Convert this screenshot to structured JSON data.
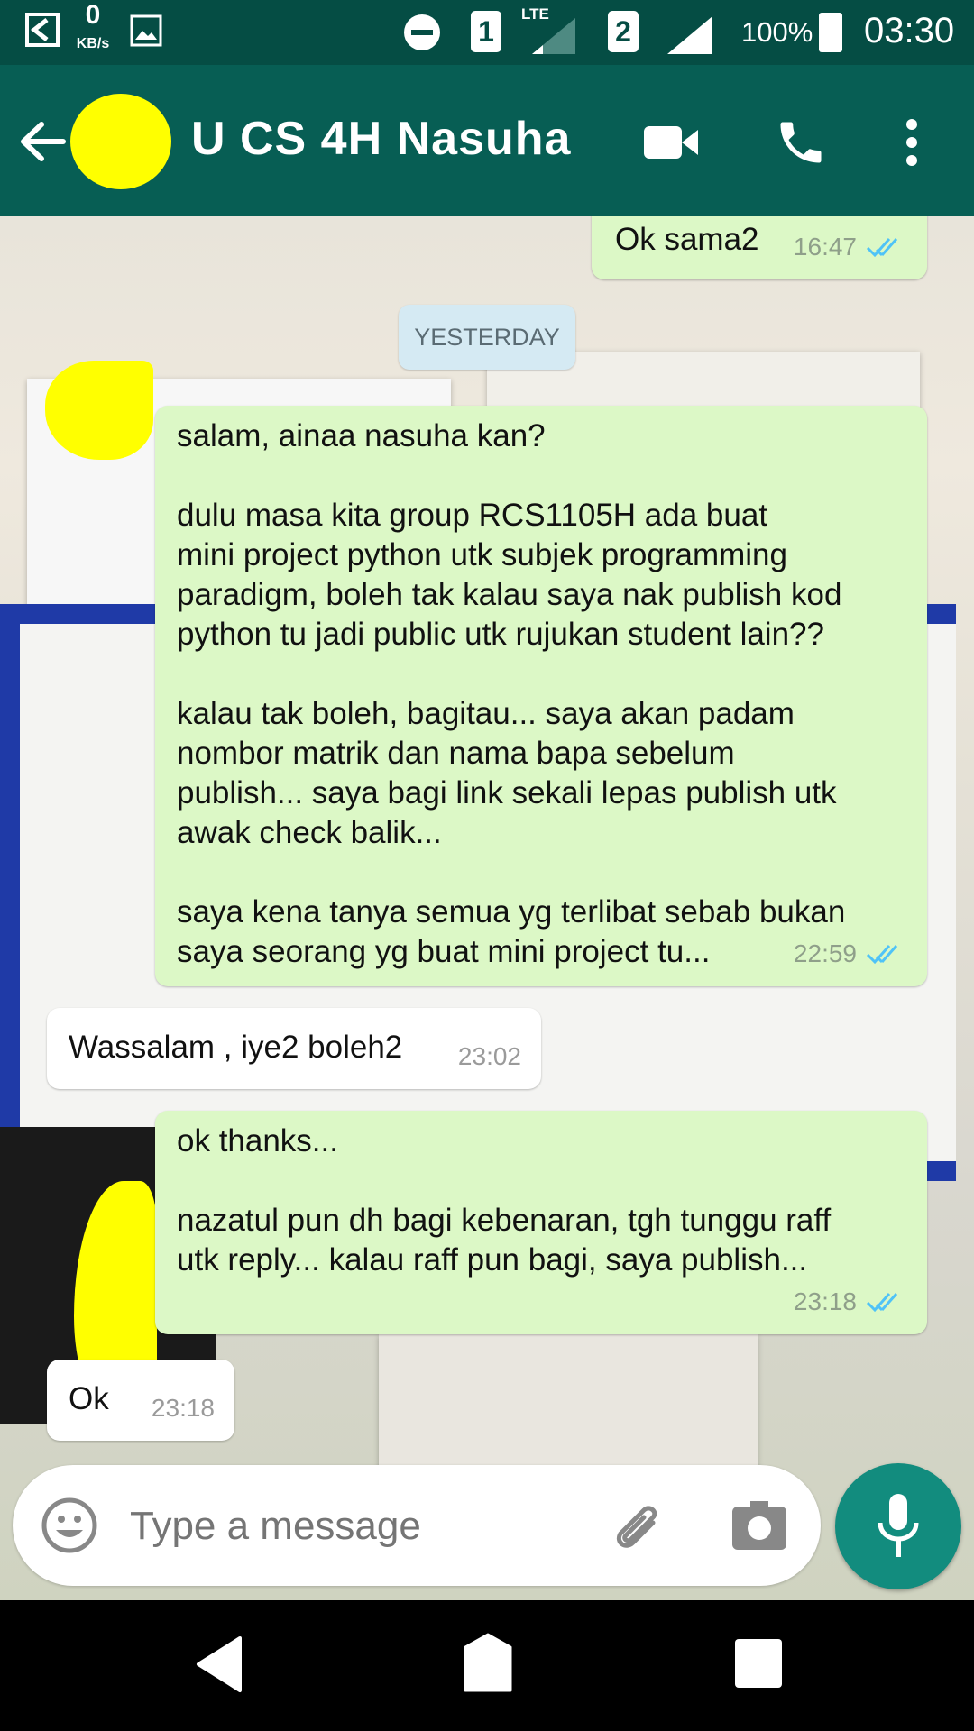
{
  "status_bar": {
    "data_speed_value": "0",
    "data_speed_unit": "KB/s",
    "sim1": "1",
    "sim2": "2",
    "network_type": "LTE",
    "battery": "100%",
    "time": "03:30"
  },
  "header": {
    "contact_name": "U CS 4H Nasuha",
    "icons": [
      "back-arrow-icon",
      "video-call-icon",
      "phone-icon",
      "more-options-icon"
    ]
  },
  "chat": {
    "date_divider": "YESTERDAY",
    "messages": [
      {
        "direction": "out",
        "text": "Ok sama2",
        "time": "16:47",
        "status": "read"
      },
      {
        "direction": "out",
        "text": "salam, ainaa nasuha kan?\n\ndulu masa kita group RCS1105H ada buat\nmini project python utk subjek programming\nparadigm, boleh tak kalau saya nak publish kod\npython tu jadi public utk rujukan student lain??\n\nkalau tak boleh, bagitau... saya akan padam\nnombor matrik dan nama bapa sebelum\npublish... saya bagi link sekali lepas publish utk\nawak check balik...\n\nsaya kena tanya semua yg terlibat sebab bukan\nsaya seorang yg buat mini project tu...",
        "time": "22:59",
        "status": "read"
      },
      {
        "direction": "in",
        "text": "Wassalam , iye2 boleh2",
        "time": "23:02"
      },
      {
        "direction": "out",
        "text": "ok thanks...\n\nnazatul pun dh bagi kebenaran, tgh tunggu raff\nutk reply... kalau raff pun bagi, saya publish...",
        "time": "23:18",
        "status": "read"
      },
      {
        "direction": "in",
        "text": "Ok",
        "time": "23:18"
      }
    ]
  },
  "composer": {
    "placeholder": "Type a message",
    "icons": [
      "emoji-icon",
      "attach-icon",
      "camera-icon",
      "mic-icon"
    ]
  },
  "colors": {
    "header": "#075e54",
    "status_bar": "#054d44",
    "outgoing_bubble": "#dcf8c6",
    "incoming_bubble": "#ffffff",
    "read_ticks": "#4fc3f7",
    "mic_button": "#128c7e"
  }
}
